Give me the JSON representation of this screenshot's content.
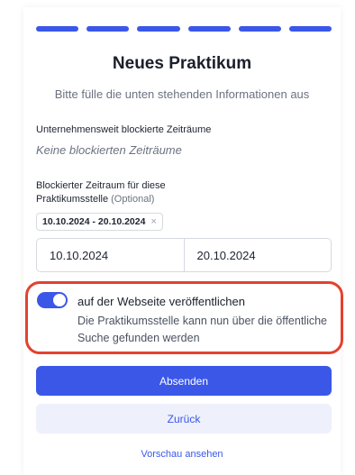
{
  "colors": {
    "accent": "#3a57e8",
    "highlight": "#e4412f",
    "secondary_bg": "#eef0fb"
  },
  "progress": {
    "total_steps": 6,
    "completed_steps": 6
  },
  "header": {
    "title": "Neues Praktikum",
    "subtitle": "Bitte fülle die unten stehenden Informationen aus"
  },
  "company_blocked": {
    "label": "Unternehmensweit blockierte Zeiträume",
    "empty_text": "Keine blockierten Zeiträume"
  },
  "position_blocked": {
    "label_line1": "Blockierter Zeitraum für diese",
    "label_line2": "Praktikumsstelle",
    "optional": "(Optional)",
    "chip": "10.10.2024 - 20.10.2024",
    "chip_remove": "×",
    "start_date": "10.10.2024",
    "end_date": "20.10.2024"
  },
  "publish_toggle": {
    "enabled": true,
    "title": "auf der Webseite veröffentlichen",
    "description": "Die Praktikumsstelle kann nun über die öffentliche Suche gefunden werden"
  },
  "actions": {
    "submit": "Absenden",
    "back": "Zurück",
    "preview": "Vorschau ansehen"
  }
}
